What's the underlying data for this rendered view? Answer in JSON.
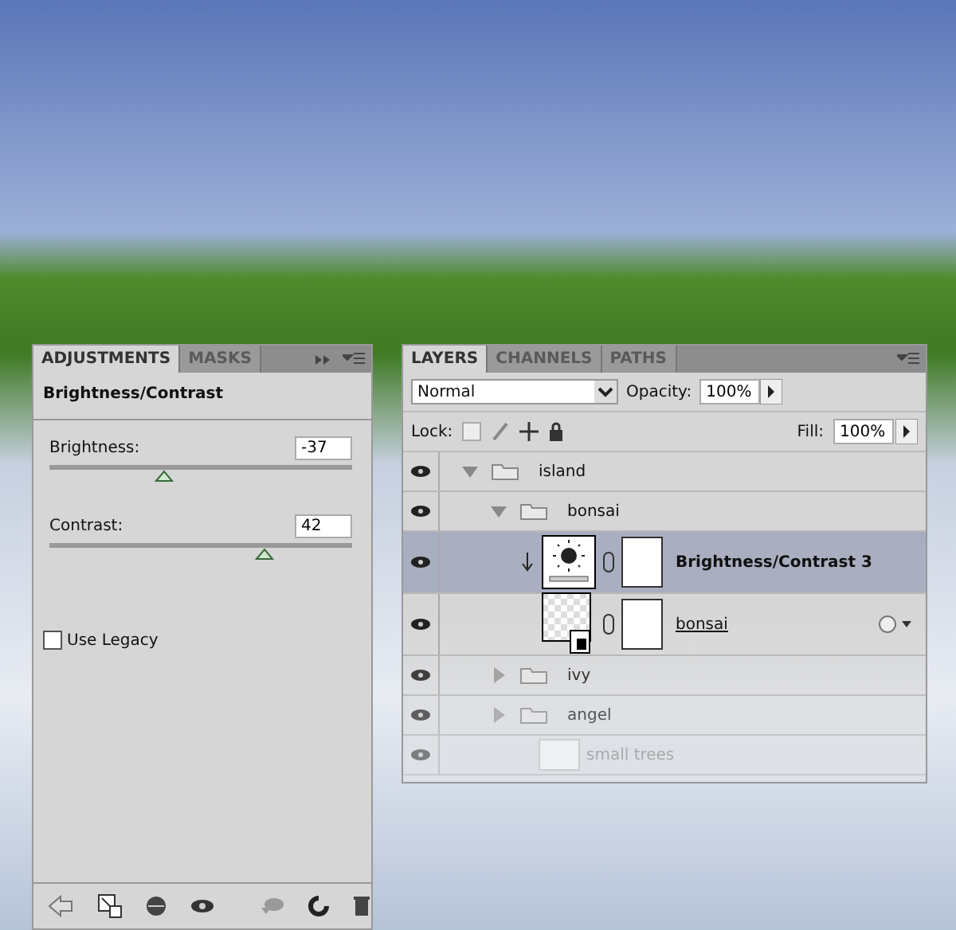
{
  "adjustments_panel": {
    "tabs": [
      {
        "label": "ADJUSTMENTS",
        "selected": true
      },
      {
        "label": "MASKS",
        "selected": false
      }
    ],
    "title": "Brightness/Contrast",
    "sliders": [
      {
        "label": "Brightness:",
        "value": "-37",
        "level": 0.38
      },
      {
        "label": "Contrast:",
        "value": "42",
        "level": 0.71
      }
    ],
    "use_legacy": {
      "label": "Use Legacy",
      "checked": false
    }
  },
  "layers_panel": {
    "tabs": [
      {
        "label": "LAYERS",
        "selected": true
      },
      {
        "label": "CHANNELS",
        "selected": false
      },
      {
        "label": "PATHS",
        "selected": false
      }
    ],
    "blend_mode": "Normal",
    "opacity_label": "Opacity:",
    "opacity": "100%",
    "lock_label": "Lock:",
    "fill_label": "Fill:",
    "fill": "100%",
    "layers": [
      {
        "name": "island",
        "kind": "folder",
        "expanded": true,
        "selected": false,
        "children": [
          {
            "name": "bonsai",
            "kind": "folder",
            "expanded": true,
            "selected": false,
            "children": [
              {
                "name": "Brightness/Contrast 3",
                "kind": "adjustment",
                "selected": true,
                "clipped": true
              },
              {
                "name": "bonsai",
                "kind": "smart",
                "selected": false,
                "clipped": false
              }
            ]
          },
          {
            "name": "ivy",
            "kind": "folder",
            "expanded": false,
            "selected": false
          },
          {
            "name": "angel",
            "kind": "folder",
            "expanded": false,
            "selected": false
          },
          {
            "name": "small trees",
            "kind": "layer",
            "selected": false,
            "clipped": false
          }
        ]
      }
    ]
  }
}
